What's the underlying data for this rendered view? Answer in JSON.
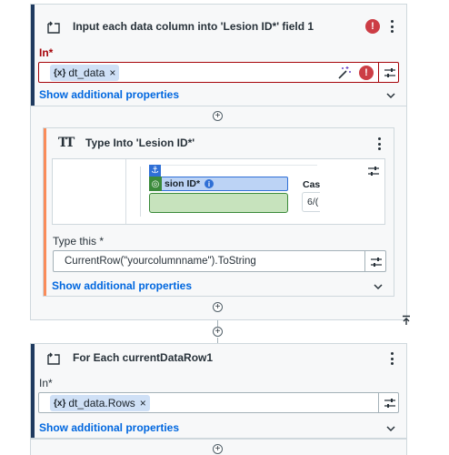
{
  "block1": {
    "title": "Input each data column into 'Lesion ID*' field 1",
    "error_badge": "!",
    "in_label": "In",
    "required_mark": "*",
    "chip_text": "dt_data",
    "chip_prefix": "{x}",
    "chip_close": "×",
    "show_more": "Show additional properties"
  },
  "inner": {
    "title": "Type Into 'Lesion ID*'",
    "title_icon": "TT",
    "preview_label": "sion ID*",
    "preview_info": "i",
    "preview_col_header": "Cas",
    "preview_col_value": "6/(",
    "type_this_label": "Type this",
    "required_mark": "*",
    "type_this_value": "CurrentRow(\"yourcolumnname\").ToString",
    "show_more": "Show additional properties"
  },
  "block2": {
    "title": "For Each currentDataRow1",
    "in_label": "In",
    "required_mark": "*",
    "chip_text": "dt_data.Rows",
    "chip_prefix": "{x}",
    "chip_close": "×",
    "show_more": "Show additional properties"
  },
  "glyphs": {
    "plus": "+"
  },
  "colors": {
    "error": "#cc3d45",
    "accent_inner": "#fa8c5a",
    "accent_block": "#1f3a5f",
    "link": "#0067df",
    "chip": "#cfe0f6"
  },
  "icons": [
    "loop-icon",
    "error-icon",
    "kebab-menu-icon",
    "variable-icon",
    "magic-wand-icon",
    "property-options-icon",
    "chevron-down-icon",
    "type-into-icon",
    "anchor-icon",
    "target-icon",
    "add-activity-icon",
    "collapse-top-icon"
  ]
}
